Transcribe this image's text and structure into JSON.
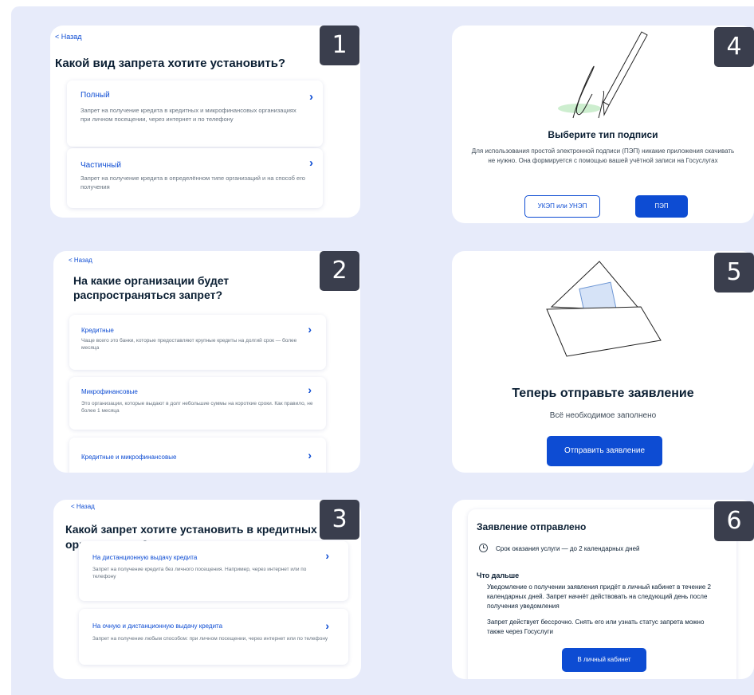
{
  "panels": {
    "p1": {
      "number": "1",
      "back": "< Назад",
      "title": "Какой вид запрета хотите установить?",
      "cards": [
        {
          "title": "Полный",
          "desc": "Запрет на получение кредита в кредитных и микрофинансовых организациях при личном посещении, через интернет и по телефону"
        },
        {
          "title": "Частичный",
          "desc": "Запрет на получение кредита в определённом типе организаций и на способ его получения"
        }
      ]
    },
    "p2": {
      "number": "2",
      "back": "< Назад",
      "title": "На какие организации будет распространяться запрет?",
      "cards": [
        {
          "title": "Кредитные",
          "desc": "Чаще всего это банки, которые предоставляют крупные кредиты на долгий срок — более месяца"
        },
        {
          "title": "Микрофинансовые",
          "desc": "Это организации, которые выдают в долг небольшие суммы на короткие сроки. Как правило, не более 1 месяца"
        },
        {
          "title": "Кредитные и микрофинансовые",
          "desc": ""
        }
      ]
    },
    "p3": {
      "number": "3",
      "back": "< Назад",
      "title": "Какой запрет хотите установить в кредитных организациях?",
      "cards": [
        {
          "title": "На дистанционную выдачу кредита",
          "desc": "Запрет на получение кредита без личного посещения. Например, через интернет или по телефону"
        },
        {
          "title": "На очную и дистанционную выдачу кредита",
          "desc": "Запрет на получение любым способом: при личном посещении, через интернет или по телефону"
        }
      ]
    },
    "p4": {
      "number": "4",
      "title": "Выберите тип подписи",
      "desc": "Для использования простой электронной подписи (ПЭП) никакие приложения скачивать не нужно. Она формируется с помощью вашей учётной записи на Госуслугах",
      "btn_outline": "УКЭП или УНЭП",
      "btn_primary": "ПЭП"
    },
    "p5": {
      "number": "5",
      "title": "Теперь отправьте заявление",
      "subtitle": "Всё необходимое заполнено",
      "button": "Отправить заявление"
    },
    "p6": {
      "number": "6",
      "title": "Заявление отправлено",
      "deadline": "Срок оказания услуги — до 2 календарных дней",
      "next_title": "Что дальше",
      "para1": "Уведомление о получении заявления придёт в личный кабинет в течение 2 календарных дней. Запрет начнёт действовать на следующий день после получения уведомления",
      "para2": "Запрет действует бессрочно. Снять его или узнать статус запрета можно также через Госуслуги",
      "button": "В личный кабинет"
    }
  },
  "colors": {
    "accent": "#0d4cd3",
    "background": "#e7ebfa",
    "badge": "#3a3e4d",
    "signature_highlight": "#cdeecf"
  },
  "icons": {
    "chevron": "chevron-right-icon",
    "clock": "clock-icon",
    "signature": "signature-pen-illustration",
    "envelope": "envelope-illustration"
  }
}
